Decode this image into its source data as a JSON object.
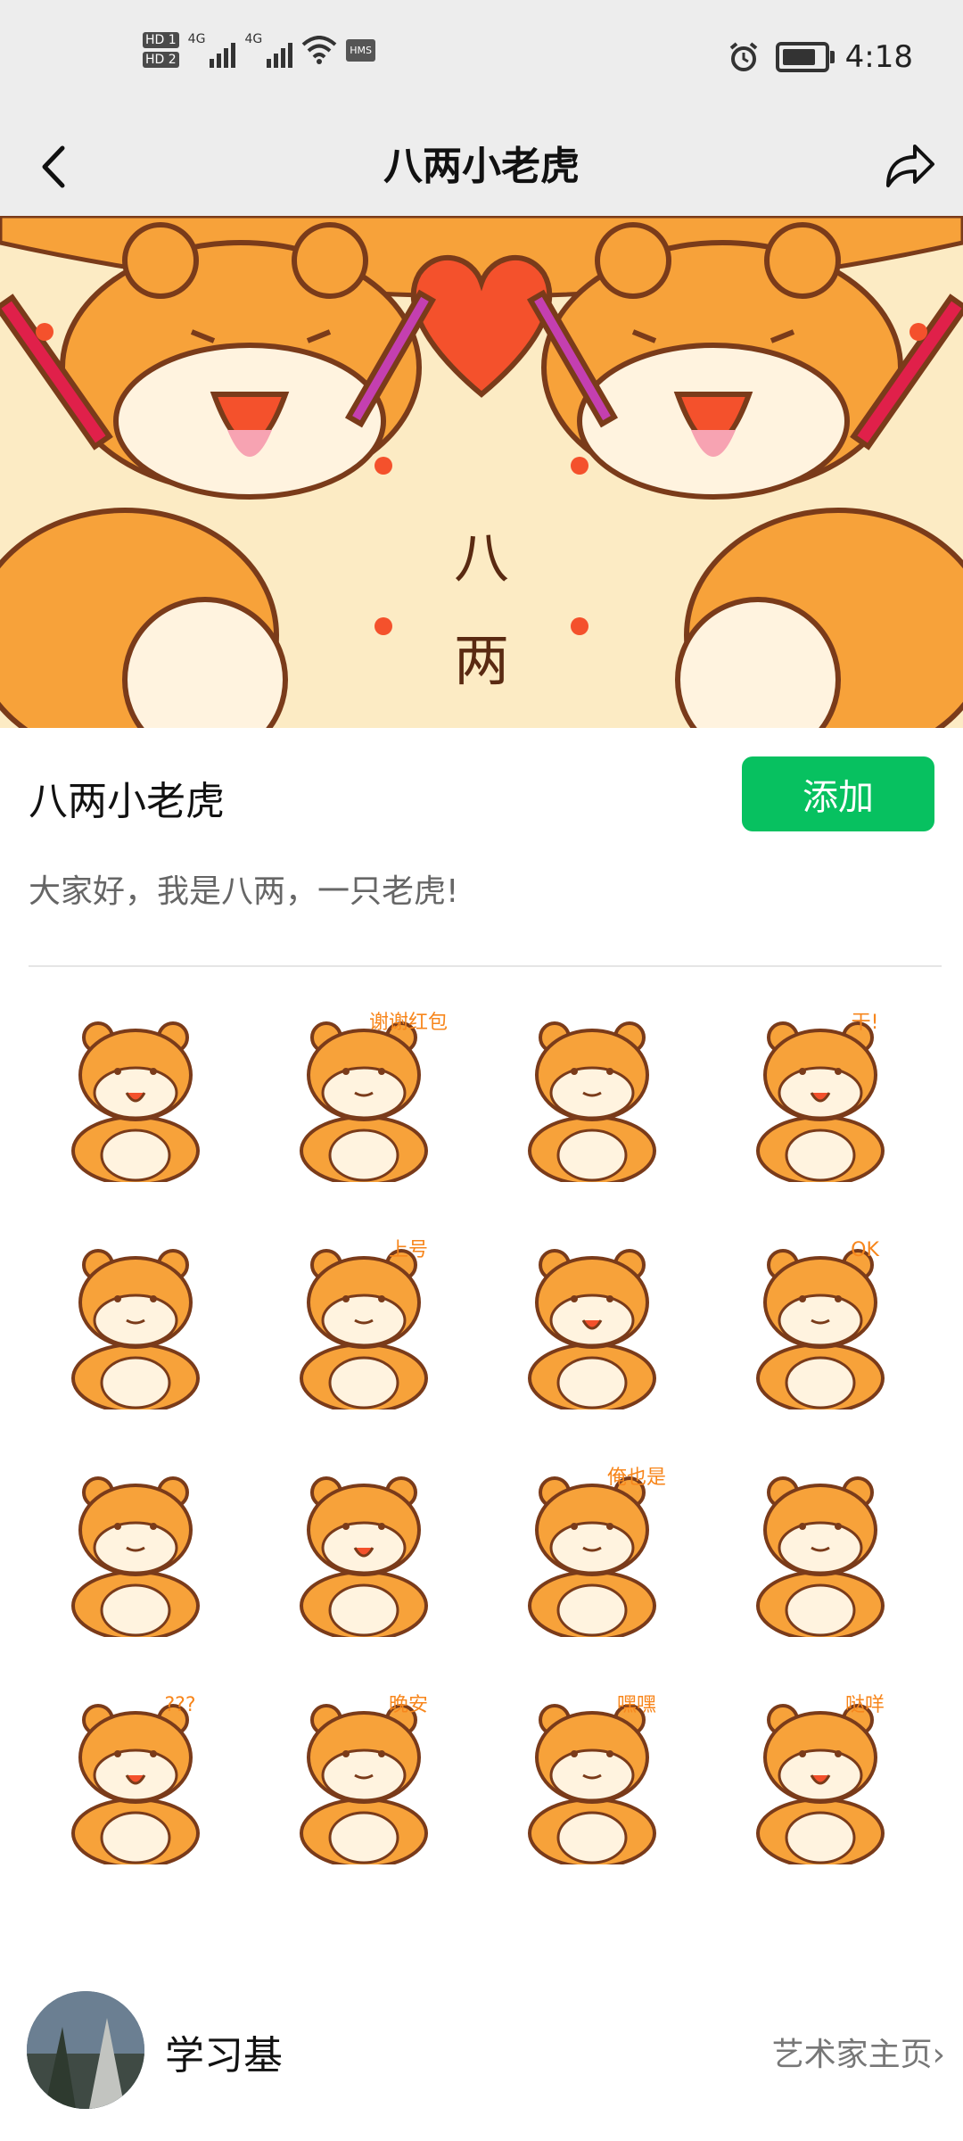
{
  "status_bar": {
    "hd1": "HD 1",
    "hd2": "HD 2",
    "net1": "4G",
    "net2": "4G",
    "hms": "HMS",
    "time": "4:18"
  },
  "nav": {
    "title": "八两小老虎",
    "back_icon": "chevron-left-icon",
    "share_icon": "share-arrow-icon"
  },
  "banner": {
    "text_top": "八",
    "text_bottom": "两"
  },
  "pack": {
    "title": "八两小老虎",
    "add_label": "添加",
    "description": "大家好，我是八两，一只老虎!"
  },
  "stickers": [
    {
      "caption": ""
    },
    {
      "caption": "谢谢红包"
    },
    {
      "caption": ""
    },
    {
      "caption": "干!"
    },
    {
      "caption": ""
    },
    {
      "caption": "上号"
    },
    {
      "caption": ""
    },
    {
      "caption": "OK"
    },
    {
      "caption": ""
    },
    {
      "caption": ""
    },
    {
      "caption": "俺也是"
    },
    {
      "caption": ""
    },
    {
      "caption": "???"
    },
    {
      "caption": "晚安"
    },
    {
      "caption": "嘿嘿"
    },
    {
      "caption": "哒咩"
    }
  ],
  "artist": {
    "name": "学习基",
    "link_label": "艺术家主页"
  },
  "colors": {
    "accent_green": "#07c160",
    "tiger_orange": "#f7a23a",
    "outline": "#7a3b1a",
    "heart": "#f4512c"
  }
}
